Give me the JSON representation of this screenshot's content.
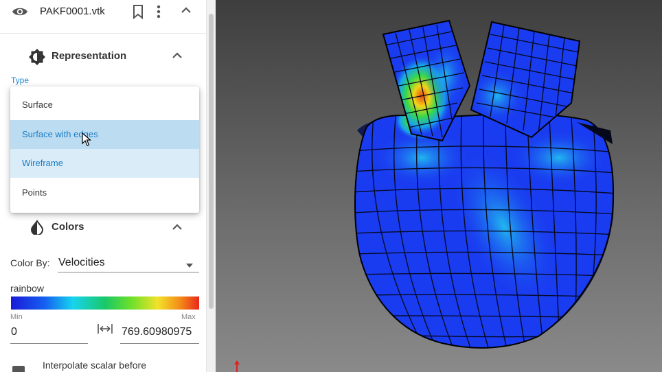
{
  "file": {
    "name": "PAKF0001.vtk"
  },
  "representation": {
    "title": "Representation",
    "type_label": "Type",
    "options": [
      "Surface",
      "Surface with edges",
      "Wireframe",
      "Points"
    ],
    "selected": "Surface with edges"
  },
  "colors": {
    "title": "Colors",
    "color_by_label": "Color By:",
    "color_by_value": "Velocities",
    "palette_name": "rainbow",
    "min_label": "Min",
    "max_label": "Max",
    "min_value": "0",
    "max_value": "769.60980975",
    "interpolate_label": "Interpolate scalar before"
  },
  "theme": {
    "accent": "#1e88d0",
    "selected_bg": "#bcdcf2",
    "hover_bg": "#d9ecf8"
  },
  "icons": [
    "eye-icon",
    "bookmark-icon",
    "more-vert-icon",
    "chevron-up-icon",
    "brightness-icon",
    "contrast-icon",
    "caret-down-icon",
    "range-arrows-icon",
    "cursor-icon"
  ]
}
